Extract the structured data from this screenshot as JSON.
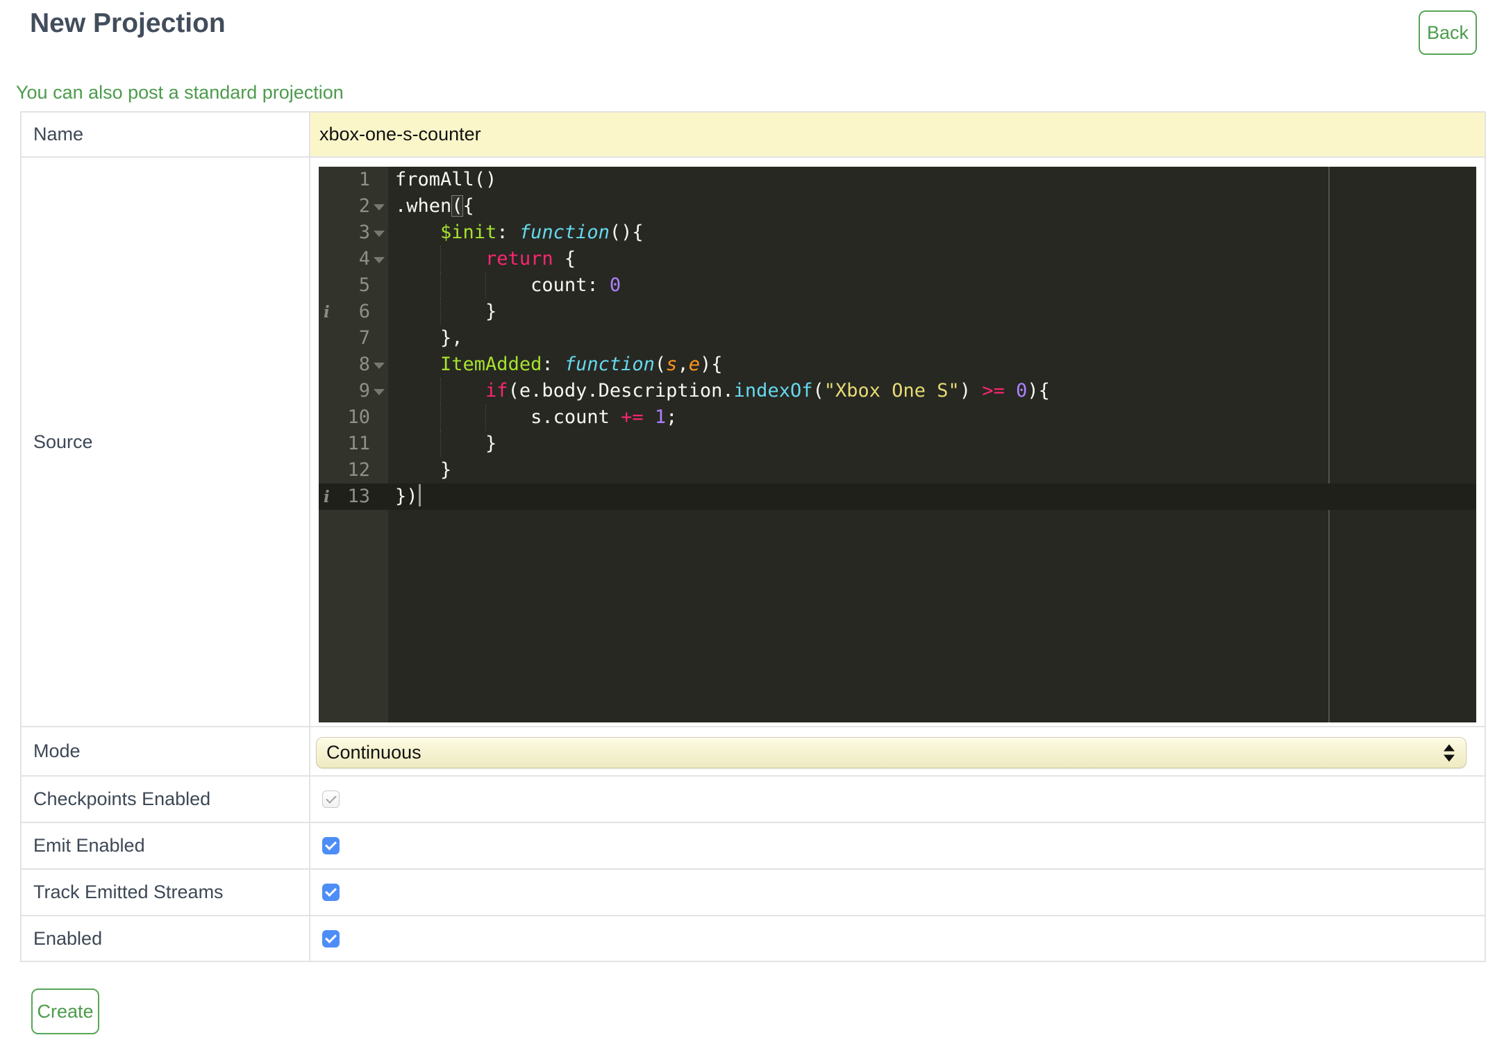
{
  "header": {
    "title": "New Projection",
    "back_label": "Back"
  },
  "link": {
    "text": "You can also post a standard projection"
  },
  "form": {
    "name": {
      "label": "Name",
      "value": "xbox-one-s-counter"
    },
    "source": {
      "label": "Source"
    },
    "mode": {
      "label": "Mode",
      "value": "Continuous"
    },
    "checkboxes": [
      {
        "label": "Checkpoints Enabled",
        "checked": true,
        "disabled": true
      },
      {
        "label": "Emit Enabled",
        "checked": true,
        "disabled": false
      },
      {
        "label": "Track Emitted Streams",
        "checked": true,
        "disabled": false
      },
      {
        "label": "Enabled",
        "checked": true,
        "disabled": false
      }
    ],
    "create_label": "Create"
  },
  "colors": {
    "accent_green": "#4C9B4C",
    "button_border_green": "#56A656",
    "heading": "#424D5C",
    "label": "#3D4855",
    "table_border": "#E3E3E3",
    "name_field_bg": "#FAF6CA",
    "select_bg_top": "#FDFBE2",
    "select_bg_bottom": "#EEEAC2",
    "select_border": "#CFCBA6",
    "checkbox_blue": "#4D8DF7",
    "checkbox_disabled_border": "#C9C9C9",
    "checkbox_disabled_check": "#A0A0A0"
  },
  "editor": {
    "active_line": 13,
    "cursor_line": 13,
    "annotations": [
      6,
      13
    ],
    "annotation_icon_glyph": "i",
    "fold_lines": [
      2,
      3,
      4,
      8,
      9
    ],
    "print_margin_col": 80,
    "colors": {
      "background": "#272822",
      "gutter_bg": "#32342B",
      "gutter_fg": "#8F908A",
      "active_line": "#1F2019",
      "ruler": "#515247",
      "cursor": "#9A9A94",
      "bracket_border": "#7D7E76",
      "guide": "#4A4B41",
      "annotation": "#8C8C86",
      "plain": "#F8F8F2",
      "keyword": "#F92672",
      "function_kw": "#66D9EF",
      "support_fn": "#66D9EF",
      "entity": "#A6E22E",
      "param": "#FD971F",
      "string": "#E6DB74",
      "number": "#AE81FF"
    },
    "lines": [
      {
        "n": 1,
        "tokens": [
          {
            "t": "fromAll()",
            "c": "p"
          }
        ]
      },
      {
        "n": 2,
        "tokens": [
          {
            "t": ".when",
            "c": "p"
          },
          {
            "t": "(",
            "c": "p bm"
          },
          {
            "t": "{",
            "c": "p"
          }
        ]
      },
      {
        "n": 3,
        "tokens": [
          {
            "t": "    ",
            "c": "p"
          },
          {
            "t": "$init",
            "c": "e"
          },
          {
            "t": ": ",
            "c": "p"
          },
          {
            "t": "function",
            "c": "f"
          },
          {
            "t": "(){",
            "c": "p"
          }
        ]
      },
      {
        "n": 4,
        "tokens": [
          {
            "t": "        ",
            "c": "p"
          },
          {
            "t": "return",
            "c": "k"
          },
          {
            "t": " {",
            "c": "p"
          }
        ]
      },
      {
        "n": 5,
        "tokens": [
          {
            "t": "            count: ",
            "c": "p"
          },
          {
            "t": "0",
            "c": "n"
          }
        ]
      },
      {
        "n": 6,
        "tokens": [
          {
            "t": "        }",
            "c": "p"
          }
        ]
      },
      {
        "n": 7,
        "tokens": [
          {
            "t": "    },",
            "c": "p"
          }
        ]
      },
      {
        "n": 8,
        "tokens": [
          {
            "t": "    ",
            "c": "p"
          },
          {
            "t": "ItemAdded",
            "c": "e"
          },
          {
            "t": ": ",
            "c": "p"
          },
          {
            "t": "function",
            "c": "f"
          },
          {
            "t": "(",
            "c": "p"
          },
          {
            "t": "s",
            "c": "v"
          },
          {
            "t": ",",
            "c": "p"
          },
          {
            "t": "e",
            "c": "v"
          },
          {
            "t": "){",
            "c": "p"
          }
        ]
      },
      {
        "n": 9,
        "tokens": [
          {
            "t": "        ",
            "c": "p"
          },
          {
            "t": "if",
            "c": "k"
          },
          {
            "t": "(e.body.Description.",
            "c": "p"
          },
          {
            "t": "indexOf",
            "c": "sf"
          },
          {
            "t": "(",
            "c": "p"
          },
          {
            "t": "\"Xbox One S\"",
            "c": "s"
          },
          {
            "t": ") ",
            "c": "p"
          },
          {
            "t": ">=",
            "c": "k"
          },
          {
            "t": " ",
            "c": "p"
          },
          {
            "t": "0",
            "c": "n"
          },
          {
            "t": "){",
            "c": "p"
          }
        ]
      },
      {
        "n": 10,
        "tokens": [
          {
            "t": "            s.count ",
            "c": "p"
          },
          {
            "t": "+=",
            "c": "k"
          },
          {
            "t": " ",
            "c": "p"
          },
          {
            "t": "1",
            "c": "n"
          },
          {
            "t": ";",
            "c": "p"
          }
        ]
      },
      {
        "n": 11,
        "tokens": [
          {
            "t": "        }",
            "c": "p"
          }
        ]
      },
      {
        "n": 12,
        "tokens": [
          {
            "t": "    }",
            "c": "p"
          }
        ]
      },
      {
        "n": 13,
        "tokens": [
          {
            "t": "})",
            "c": "p"
          }
        ]
      }
    ]
  }
}
